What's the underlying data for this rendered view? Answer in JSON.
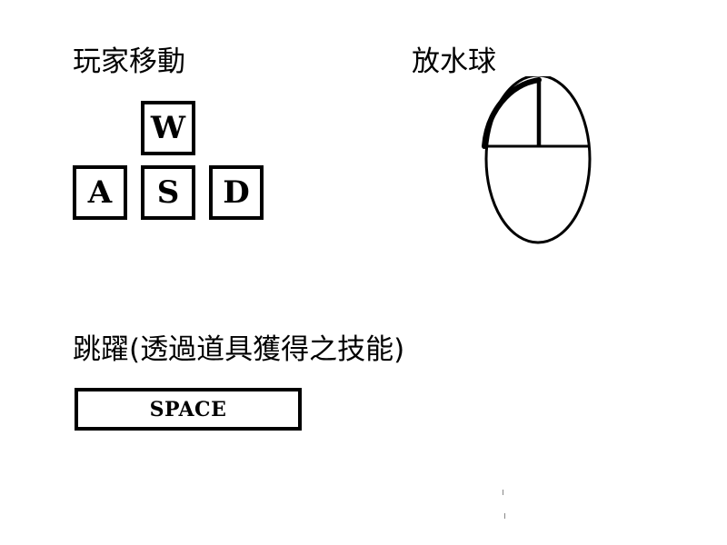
{
  "sections": {
    "move": {
      "title": "玩家移動",
      "keys": {
        "up": "W",
        "left": "A",
        "down": "S",
        "right": "D"
      }
    },
    "shoot": {
      "title": "放水球",
      "icon": "mouse-left-click-icon"
    },
    "jump": {
      "title": "跳躍(透過道具獲得之技能)",
      "key": "SPACE"
    }
  }
}
